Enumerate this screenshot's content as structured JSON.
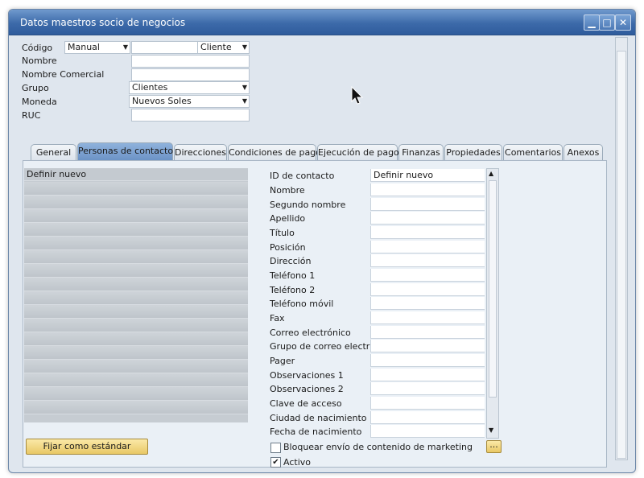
{
  "window": {
    "title": "Datos maestros socio de negocios",
    "minimize_glyph": "▁",
    "maximize_glyph": "□",
    "close_glyph": "✕"
  },
  "header": {
    "codigo_label": "Código",
    "codigo_series": "Manual",
    "codigo_value": "",
    "tipo_value": "Cliente",
    "nombre_label": "Nombre",
    "nombre_value": "",
    "nombre_comercial_label": "Nombre Comercial",
    "nombre_comercial_value": "",
    "grupo_label": "Grupo",
    "grupo_value": "Clientes",
    "moneda_label": "Moneda",
    "moneda_value": "Nuevos Soles",
    "ruc_label": "RUC",
    "ruc_value": ""
  },
  "tabs": [
    {
      "label": "General"
    },
    {
      "label": "Personas de contacto",
      "active": true
    },
    {
      "label": "Direcciones"
    },
    {
      "label": "Condiciones de pago"
    },
    {
      "label": "Ejecución de pago"
    },
    {
      "label": "Finanzas"
    },
    {
      "label": "Propiedades"
    },
    {
      "label": "Comentarios"
    },
    {
      "label": "Anexos"
    }
  ],
  "contacts_list": {
    "first_item": "Definir nuevo"
  },
  "contact_fields": [
    {
      "label": "ID de contacto",
      "value": "Definir nuevo"
    },
    {
      "label": "Nombre",
      "value": ""
    },
    {
      "label": "Segundo nombre",
      "value": ""
    },
    {
      "label": "Apellido",
      "value": ""
    },
    {
      "label": "Título",
      "value": ""
    },
    {
      "label": "Posición",
      "value": ""
    },
    {
      "label": "Dirección",
      "value": ""
    },
    {
      "label": "Teléfono 1",
      "value": ""
    },
    {
      "label": "Teléfono 2",
      "value": ""
    },
    {
      "label": "Teléfono móvil",
      "value": ""
    },
    {
      "label": "Fax",
      "value": ""
    },
    {
      "label": "Correo electrónico",
      "value": ""
    },
    {
      "label": "Grupo de correo electr…",
      "value": ""
    },
    {
      "label": "Pager",
      "value": ""
    },
    {
      "label": "Observaciones 1",
      "value": ""
    },
    {
      "label": "Observaciones 2",
      "value": ""
    },
    {
      "label": "Clave de acceso",
      "value": ""
    },
    {
      "label": "Ciudad de nacimiento",
      "value": ""
    },
    {
      "label": "Fecha de nacimiento",
      "value": ""
    }
  ],
  "footer": {
    "set_default_label": "Fijar como estándar",
    "block_marketing_label": "Bloquear envío de contenido de marketing",
    "block_marketing_checked": false,
    "ellipsis_label": "...",
    "activo_label": "Activo",
    "activo_checked": true
  }
}
